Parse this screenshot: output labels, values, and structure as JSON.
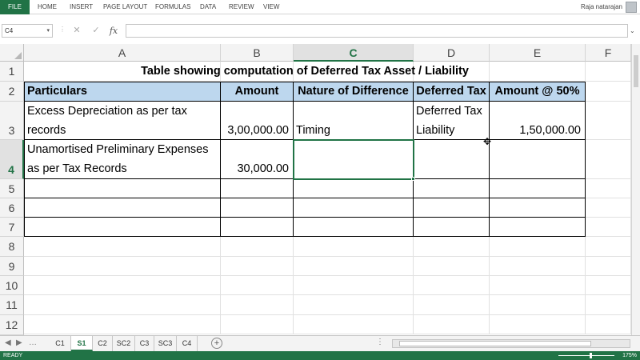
{
  "ribbon": {
    "file": "FILE",
    "tabs": [
      "HOME",
      "INSERT",
      "PAGE LAYOUT",
      "FORMULAS",
      "DATA",
      "REVIEW",
      "VIEW"
    ],
    "user": "Raja natarajan"
  },
  "formula_bar": {
    "name_box": "C4",
    "formula": ""
  },
  "columns": [
    "A",
    "B",
    "C",
    "D",
    "E",
    "F"
  ],
  "rows": [
    "1",
    "2",
    "3",
    "4",
    "5",
    "6",
    "7",
    "8",
    "9",
    "10",
    "11",
    "12"
  ],
  "sheet": {
    "title": "Table showing computation of Deferred Tax Asset / Liability",
    "headers": [
      "Particulars",
      "Amount",
      "Nature of Difference",
      "Deferred Tax",
      "Amount @ 50%"
    ],
    "row3": {
      "particulars_line1": "Excess Depreciation as per tax",
      "particulars_line2": "records",
      "amount": "3,00,000.00",
      "nature": "Timing",
      "deferred_line1": "Deferred Tax",
      "deferred_line2": "Liability",
      "amount50": "1,50,000.00"
    },
    "row4": {
      "particulars_line1": "Unamortised Preliminary Expenses",
      "particulars_line2": "as per Tax Records",
      "amount": "30,000.00"
    }
  },
  "sheet_tabs": [
    "C1",
    "S1",
    "C2",
    "SC2",
    "C3",
    "SC3",
    "C4"
  ],
  "active_tab": "S1",
  "status": {
    "ready": "READY",
    "zoom": "175%"
  }
}
